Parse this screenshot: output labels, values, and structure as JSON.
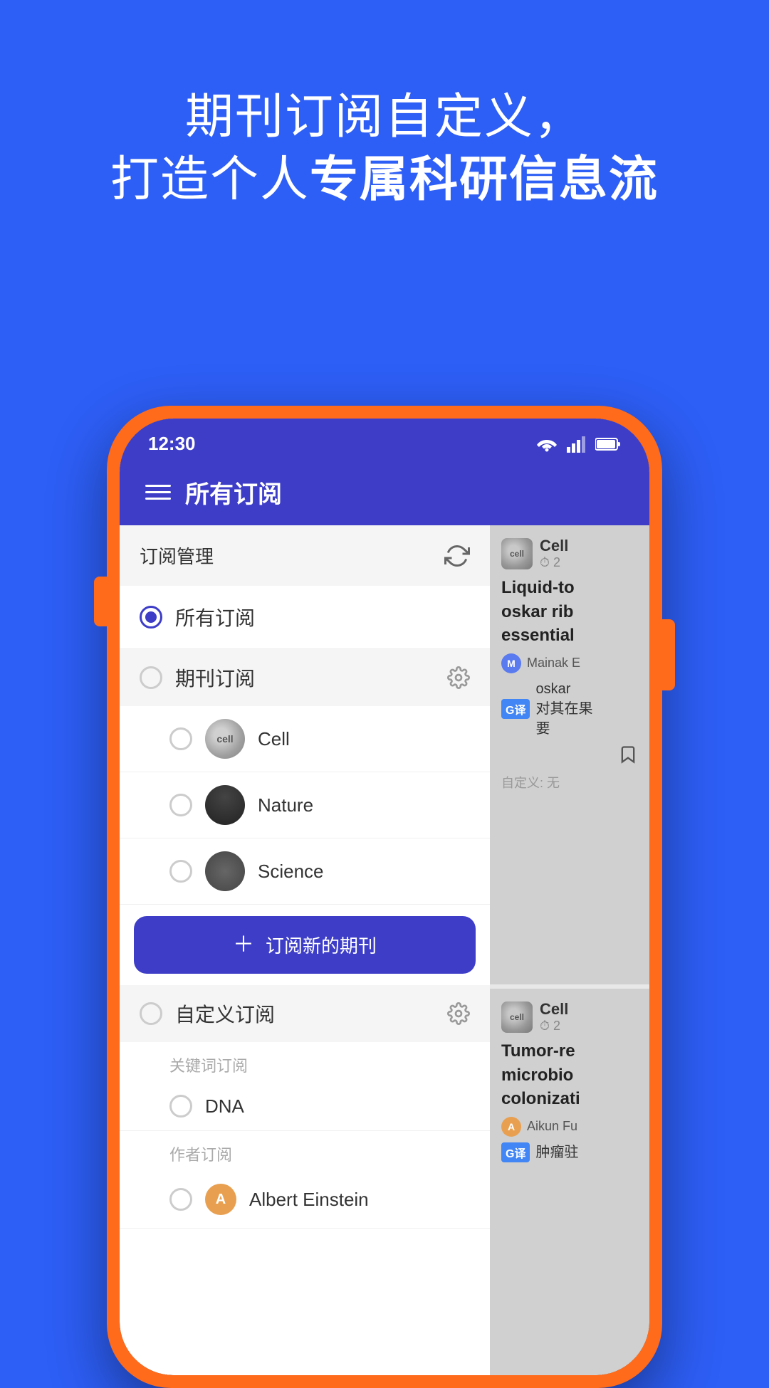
{
  "hero": {
    "line1": "期刊订阅自定义，",
    "line2_plain": "打造个人",
    "line2_bold": "专属科研信息流"
  },
  "status_bar": {
    "time": "12:30"
  },
  "nav": {
    "title": "所有订阅"
  },
  "subscription_panel": {
    "section_title": "订阅管理",
    "all_subs_label": "所有订阅",
    "journal_section_label": "期刊订阅",
    "journals": [
      {
        "name": "Cell"
      },
      {
        "name": "Nature"
      },
      {
        "name": "Science"
      }
    ],
    "subscribe_btn_label": "订阅新的期刊",
    "custom_section_label": "自定义订阅",
    "keyword_section_label": "关键词订阅",
    "keyword_item": "DNA",
    "author_section_label": "作者订阅",
    "author_item": "Albert Einstein"
  },
  "articles": [
    {
      "journal": "Cell",
      "time": "2",
      "title": "Liquid-to\noskar rib\nessential",
      "author_initial": "M",
      "author_name": "Mainak E",
      "translated_prefix": "oskar",
      "translated_text": "对其在果\n要"
    },
    {
      "journal": "Cell",
      "time": "2",
      "title": "Tumor-re\nmicrobio\ncolonizati",
      "author_initial": "A",
      "author_name": "Aikun Fu",
      "translated_prefix": "",
      "translated_text": "肿瘤驻"
    }
  ],
  "custom_label": "自定义: 无"
}
